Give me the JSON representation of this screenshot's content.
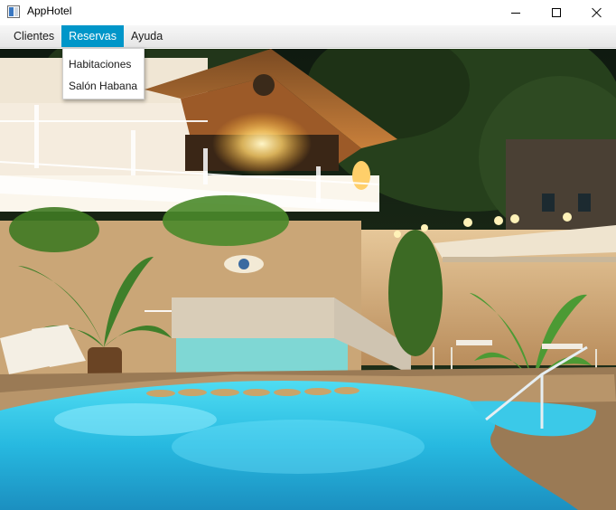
{
  "window": {
    "title": "AppHotel",
    "controls": {
      "minimize": "minimize",
      "maximize": "maximize",
      "close": "close"
    }
  },
  "menubar": {
    "items": [
      {
        "label": "Clientes",
        "active": false
      },
      {
        "label": "Reservas",
        "active": true
      },
      {
        "label": "Ayuda",
        "active": false
      }
    ]
  },
  "dropdown": {
    "items": [
      {
        "label": "Habitaciones"
      },
      {
        "label": "Salón Habana"
      }
    ]
  },
  "colors": {
    "accent": "#0096c9",
    "pool": "#3fd0ec",
    "night_sky": "#1b2a18",
    "wall": "#d8b98a"
  },
  "icons": {
    "app": "app-window-icon"
  }
}
